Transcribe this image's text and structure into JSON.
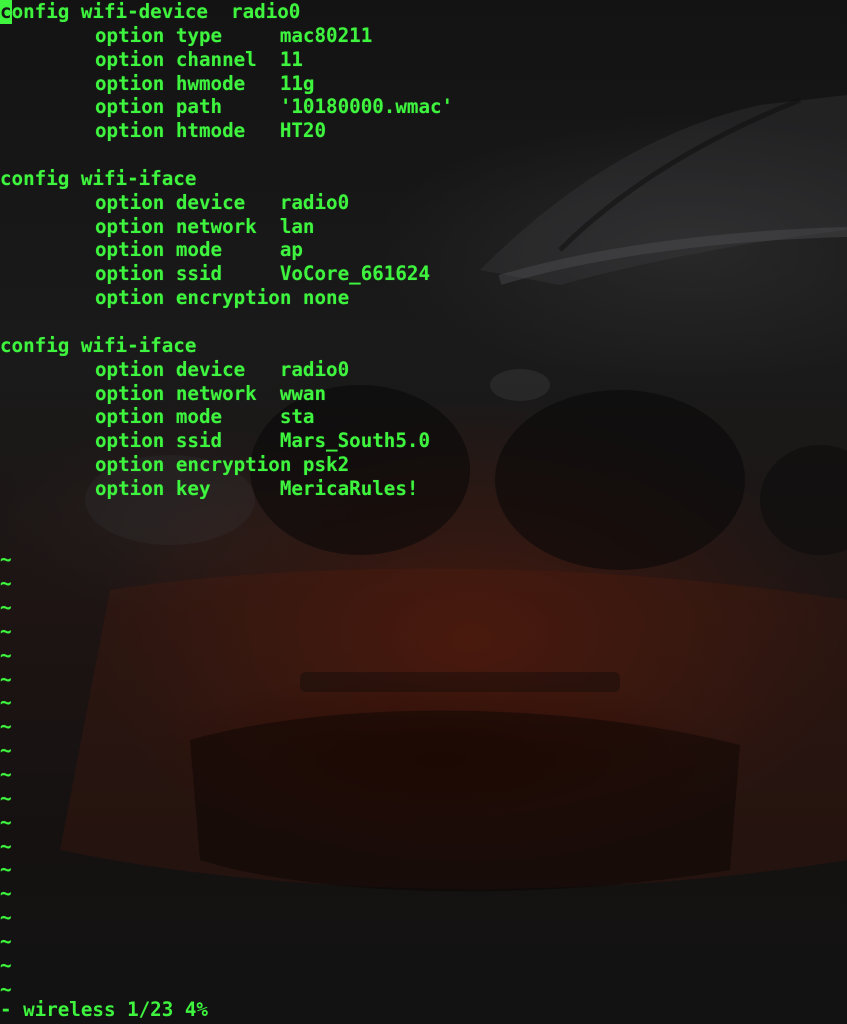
{
  "editor": {
    "status_line": "- wireless 1/23 4%",
    "tilde": "~",
    "tilde_rows": 19
  },
  "file": {
    "name": "wireless",
    "lines": [
      {
        "indent": false,
        "text": "config wifi-device  radio0",
        "cursor": true
      },
      {
        "indent": true,
        "text": "option type     mac80211"
      },
      {
        "indent": true,
        "text": "option channel  11"
      },
      {
        "indent": true,
        "text": "option hwmode   11g"
      },
      {
        "indent": true,
        "text": "option path     '10180000.wmac'"
      },
      {
        "indent": true,
        "text": "option htmode   HT20"
      },
      {
        "indent": false,
        "text": ""
      },
      {
        "indent": false,
        "text": "config wifi-iface"
      },
      {
        "indent": true,
        "text": "option device   radio0"
      },
      {
        "indent": true,
        "text": "option network  lan"
      },
      {
        "indent": true,
        "text": "option mode     ap"
      },
      {
        "indent": true,
        "text": "option ssid     VoCore_661624"
      },
      {
        "indent": true,
        "text": "option encryption none"
      },
      {
        "indent": false,
        "text": ""
      },
      {
        "indent": false,
        "text": "config wifi-iface"
      },
      {
        "indent": true,
        "text": "option device   radio0"
      },
      {
        "indent": true,
        "text": "option network  wwan"
      },
      {
        "indent": true,
        "text": "option mode     sta"
      },
      {
        "indent": true,
        "text": "option ssid     Mars_South5.0"
      },
      {
        "indent": true,
        "text": "option encryption psk2"
      },
      {
        "indent": true,
        "text": "option key      MericaRules!"
      },
      {
        "indent": false,
        "text": ""
      },
      {
        "indent": false,
        "text": ""
      }
    ]
  },
  "colors": {
    "text": "#3ef43e",
    "background": "#151515"
  }
}
